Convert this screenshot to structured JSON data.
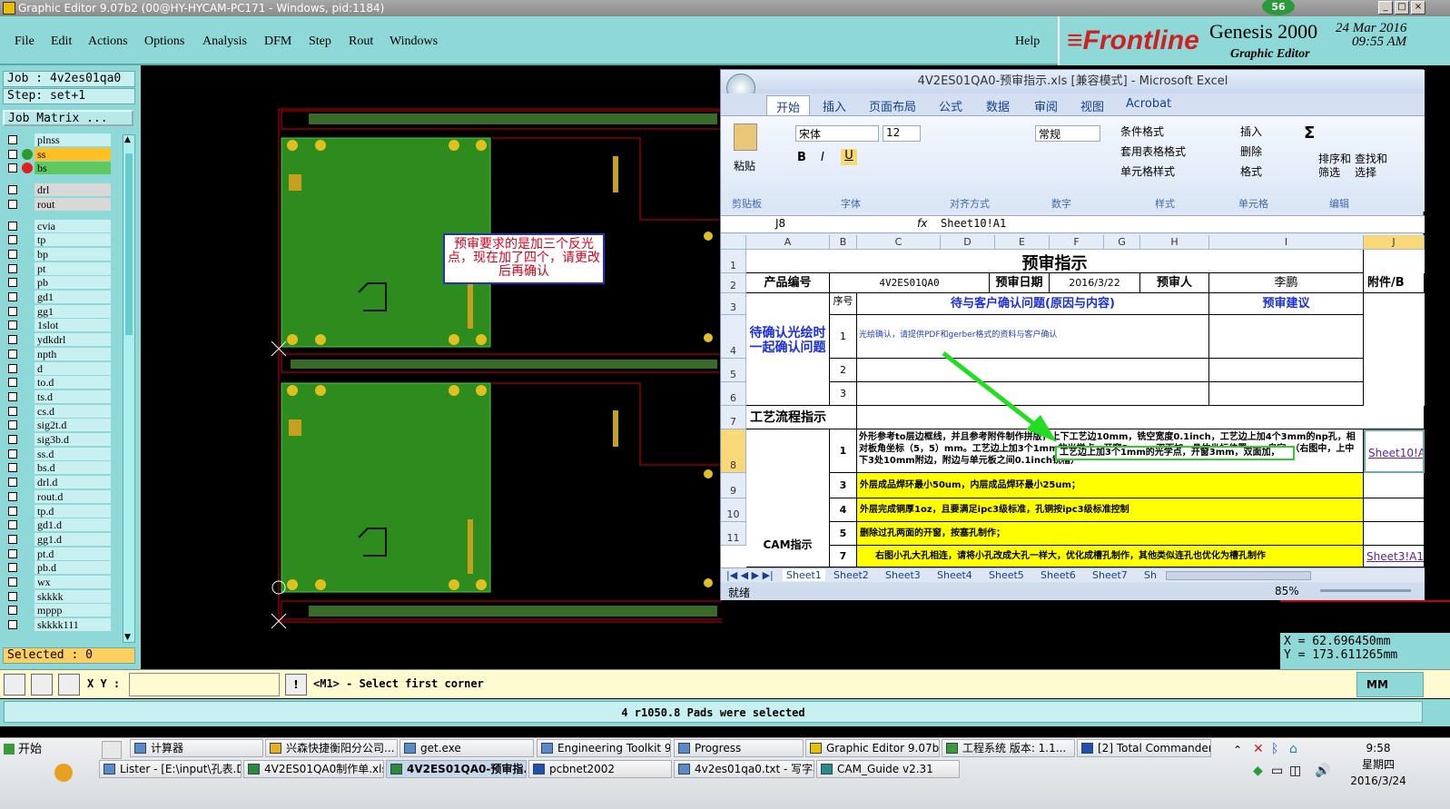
{
  "window": {
    "title": "Graphic Editor 9.07b2 (00@HY-HYCAM-PC171 - Windows, pid:1184)",
    "badge": "56"
  },
  "menu": {
    "file": "File",
    "edit": "Edit",
    "actions": "Actions",
    "options": "Options",
    "analysis": "Analysis",
    "dfm": "DFM",
    "step": "Step",
    "rout": "Rout",
    "windows": "Windows",
    "help": "Help"
  },
  "brand": {
    "logo_a": "Frontline",
    "product": "Genesis 2000",
    "subtitle": "Graphic Editor",
    "date": "24 Mar 2016",
    "time": "09:55 AM"
  },
  "job": {
    "job": "Job : 4v2es01qa0",
    "step": "Step: set+1",
    "matrix": "Job Matrix ...",
    "selected": "Selected : 0"
  },
  "layers": [
    "plnss",
    "ss",
    "bs",
    "drl",
    "rout",
    "cvia",
    "tp",
    "bp",
    "pt",
    "pb",
    "gd1",
    "gg1",
    "1slot",
    "ydkdrl",
    "npth",
    "d",
    "to.d",
    "ts.d",
    "cs.d",
    "sig2t.d",
    "sig3b.d",
    "ss.d",
    "bs.d",
    "drl.d",
    "rout.d",
    "tp.d",
    "gd1.d",
    "gg1.d",
    "pt.d",
    "pb.d",
    "wx",
    "skkkk",
    "mppp",
    "skkkk111"
  ],
  "note": {
    "text": "预审要求的是加三个反光点，现在加了四个，请更改后再确认"
  },
  "cmd": {
    "xy_label": "X Y :",
    "prompt": "<M1> - Select first corner",
    "status": "4 r1050.8 Pads were selected",
    "units": "MM"
  },
  "coords": {
    "x": "X  =  62.696450mm",
    "y": "Y  =  173.611265mm"
  },
  "excel": {
    "title": "4V2ES01QA0-预审指示.xls  [兼容模式] - Microsoft Excel",
    "tabs": [
      "开始",
      "插入",
      "页面布局",
      "公式",
      "数据",
      "审阅",
      "视图",
      "Acrobat"
    ],
    "font": "宋体",
    "size": "12",
    "numfmt": "常规",
    "groups": [
      "剪贴板",
      "字体",
      "对齐方式",
      "数字",
      "样式",
      "单元格",
      "编辑"
    ],
    "paste": "粘贴",
    "styles": [
      "条件格式",
      "套用表格格式",
      "单元格样式"
    ],
    "cells_btns": [
      "插入",
      "删除",
      "格式"
    ],
    "edit_btns": [
      "排序和筛选",
      "查找和选择"
    ],
    "namebox": "J8",
    "formula": "Sheet10!A1",
    "cols": [
      "A",
      "B",
      "C",
      "D",
      "E",
      "F",
      "G",
      "H",
      "I",
      "J"
    ],
    "rows": [
      "1",
      "2",
      "3",
      "4",
      "5",
      "6",
      "7",
      "8",
      "9",
      "10",
      "11"
    ],
    "heading": "预审指示",
    "r2": {
      "a": "产品编号",
      "c": "4V2ES01QA0",
      "d": "预审日期",
      "f": "2016/3/22",
      "g": "预审人",
      "i": "李鹏",
      "j": "附件/B"
    },
    "r3": {
      "b": "序号",
      "c": "待与客户确认问题(原因与内容)",
      "i": "预审建议"
    },
    "pending": "待确认光绘时一起确认问题",
    "r4": {
      "b": "1",
      "c": "光绘确认，请提供PDF和gerber格式的资料与客户确认"
    },
    "r5": {
      "b": "2"
    },
    "r6": {
      "b": "3"
    },
    "r7": {
      "a": "工艺流程指示"
    },
    "r8": {
      "b": "1",
      "c": "外形参考to层边框线，并且参考附件制作拼版，上下工艺边10mm，铣空宽度0.1inch，工艺边上加4个3mm的np孔，相对板角坐标（5，5）mm。工艺边上加3个1mm的光学点，开窗3mm，双面加，具体坐标位置cam自定。（右图中，上中下3处10mm附边，附边与单元板之间0.1inch铣槽）",
      "highlight": "工艺边上加3个1mm的光学点，开窗3mm，双面加，",
      "j": "Sheet10!A1"
    },
    "r9": {
      "b": "3",
      "c": "外层成品焊环最小50um，内层成品焊环最小25um；"
    },
    "r10": {
      "b": "4",
      "c": "外层完成铜厚1oz，且要满足ipc3级标准，孔铜按ipc3级标准控制"
    },
    "r11": {
      "b": "5",
      "c": "删除过孔两面的开窗，按塞孔制作；"
    },
    "r12": {
      "b": "7",
      "c": "右图小孔大孔相连，请将小孔改成大孔一样大，优化成槽孔制作，其他类似连孔也优化为槽孔制作",
      "j": "Sheet3!A1"
    },
    "cam": "CAM指示",
    "sheets": [
      "Sheet1",
      "Sheet2",
      "Sheet3",
      "Sheet4",
      "Sheet5",
      "Sheet6",
      "Sheet7",
      "Sh"
    ],
    "status": "就绪",
    "zoom": "85%"
  },
  "taskbar": {
    "start": "开始",
    "row1": [
      "计算器",
      "兴森快捷衡阳分公司...",
      "get.exe",
      "Engineering Toolkit 9.0...",
      "Progress",
      "Graphic Editor 9.07b2 ...",
      "工程系统  版本: 1.1...",
      "[2] Total Commander 7..."
    ],
    "row2": [
      "Lister - [E:\\input\\孔表.D...",
      "4V2ES01QA0制作单.xls ...",
      "4V2ES01QA0-预审指...",
      "pcbnet2002",
      "4v2es01qa0.txt - 写字板",
      "CAM_Guide v2.31"
    ],
    "time": "9:58",
    "weekday": "星期四",
    "date": "2016/3/24"
  }
}
